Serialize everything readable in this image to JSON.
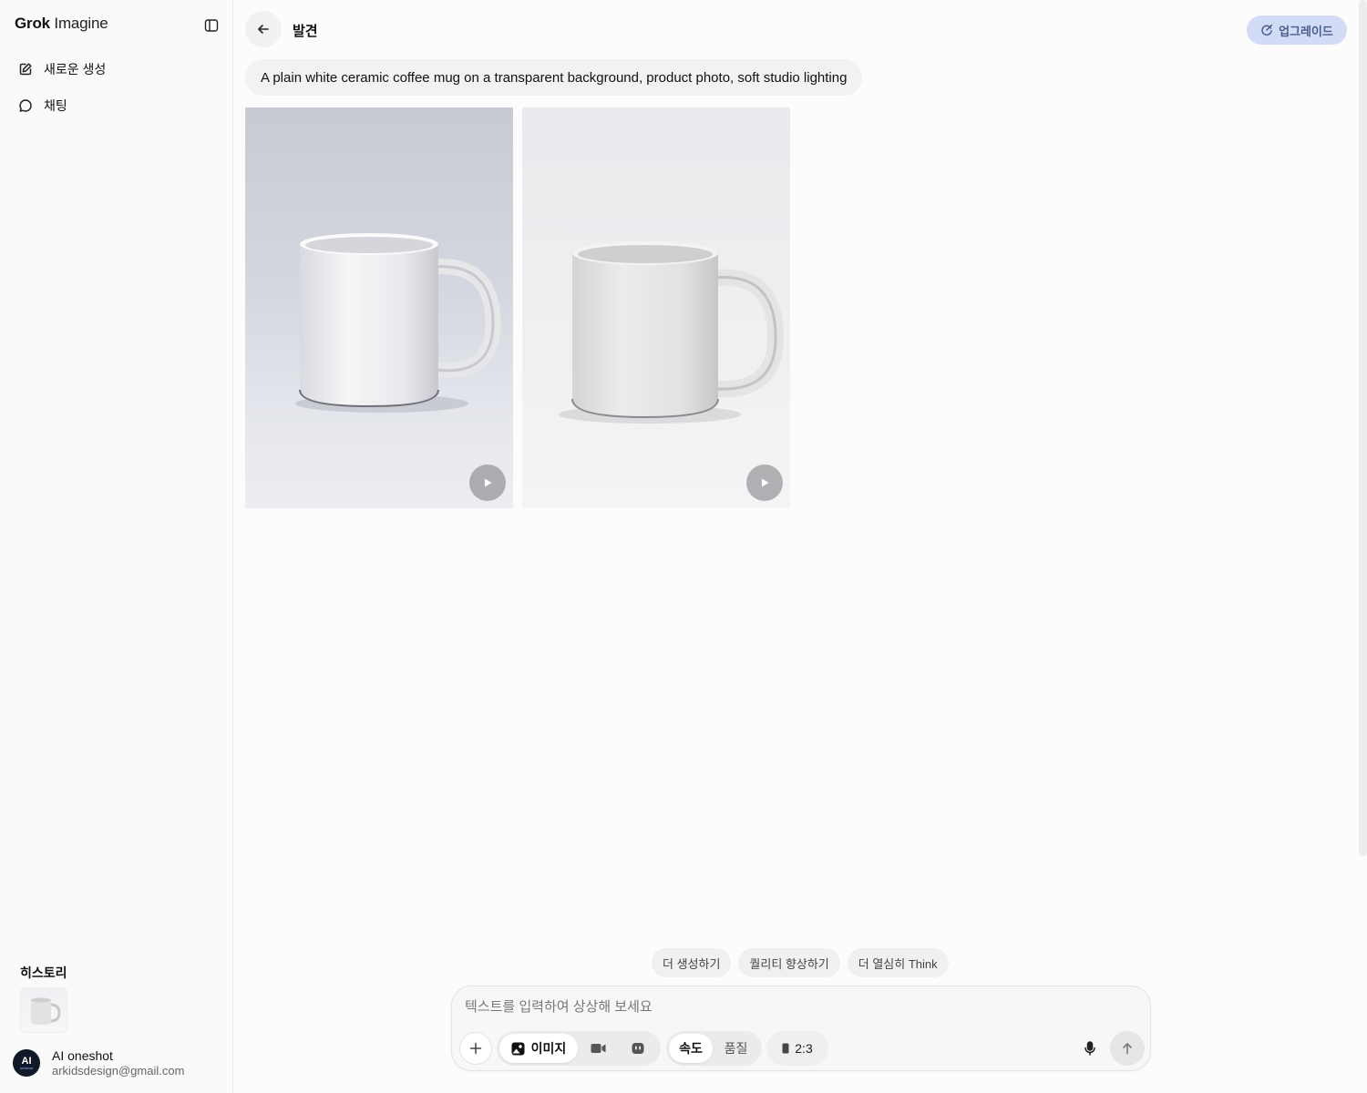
{
  "sidebar": {
    "brand_bold": "Grok",
    "brand_light": "Imagine",
    "nav": [
      {
        "label": "새로운 생성",
        "icon": "edit-icon"
      },
      {
        "label": "채팅",
        "icon": "chat-bubble-icon"
      }
    ],
    "history_title": "히스토리",
    "user": {
      "avatar_text": "AI",
      "avatar_subtext": "oneshot",
      "name": "AI oneshot",
      "email": "arkidsdesign@gmail.com"
    }
  },
  "header": {
    "title": "발견",
    "upgrade_label": "업그레이드"
  },
  "prompt": "A plain white ceramic coffee mug on a transparent background, product photo, soft studio lighting",
  "results": [
    {
      "kind": "image",
      "subject": "white mug",
      "has_play": true
    },
    {
      "kind": "image",
      "subject": "white mug",
      "has_play": true
    }
  ],
  "suggestions": [
    "더 생성하기",
    "퀄리티 향상하기",
    "더 열심히 Think"
  ],
  "composer": {
    "placeholder": "텍스트를 입력하여 상상해 보세요",
    "mode_image_label": "이미지",
    "speed_label": "속도",
    "quality_label": "품질",
    "aspect_ratio": "2:3"
  },
  "colors": {
    "upgrade_bg": "#d3dcf7",
    "upgrade_text": "#4a5d8c",
    "background": "#fcfcfc"
  }
}
